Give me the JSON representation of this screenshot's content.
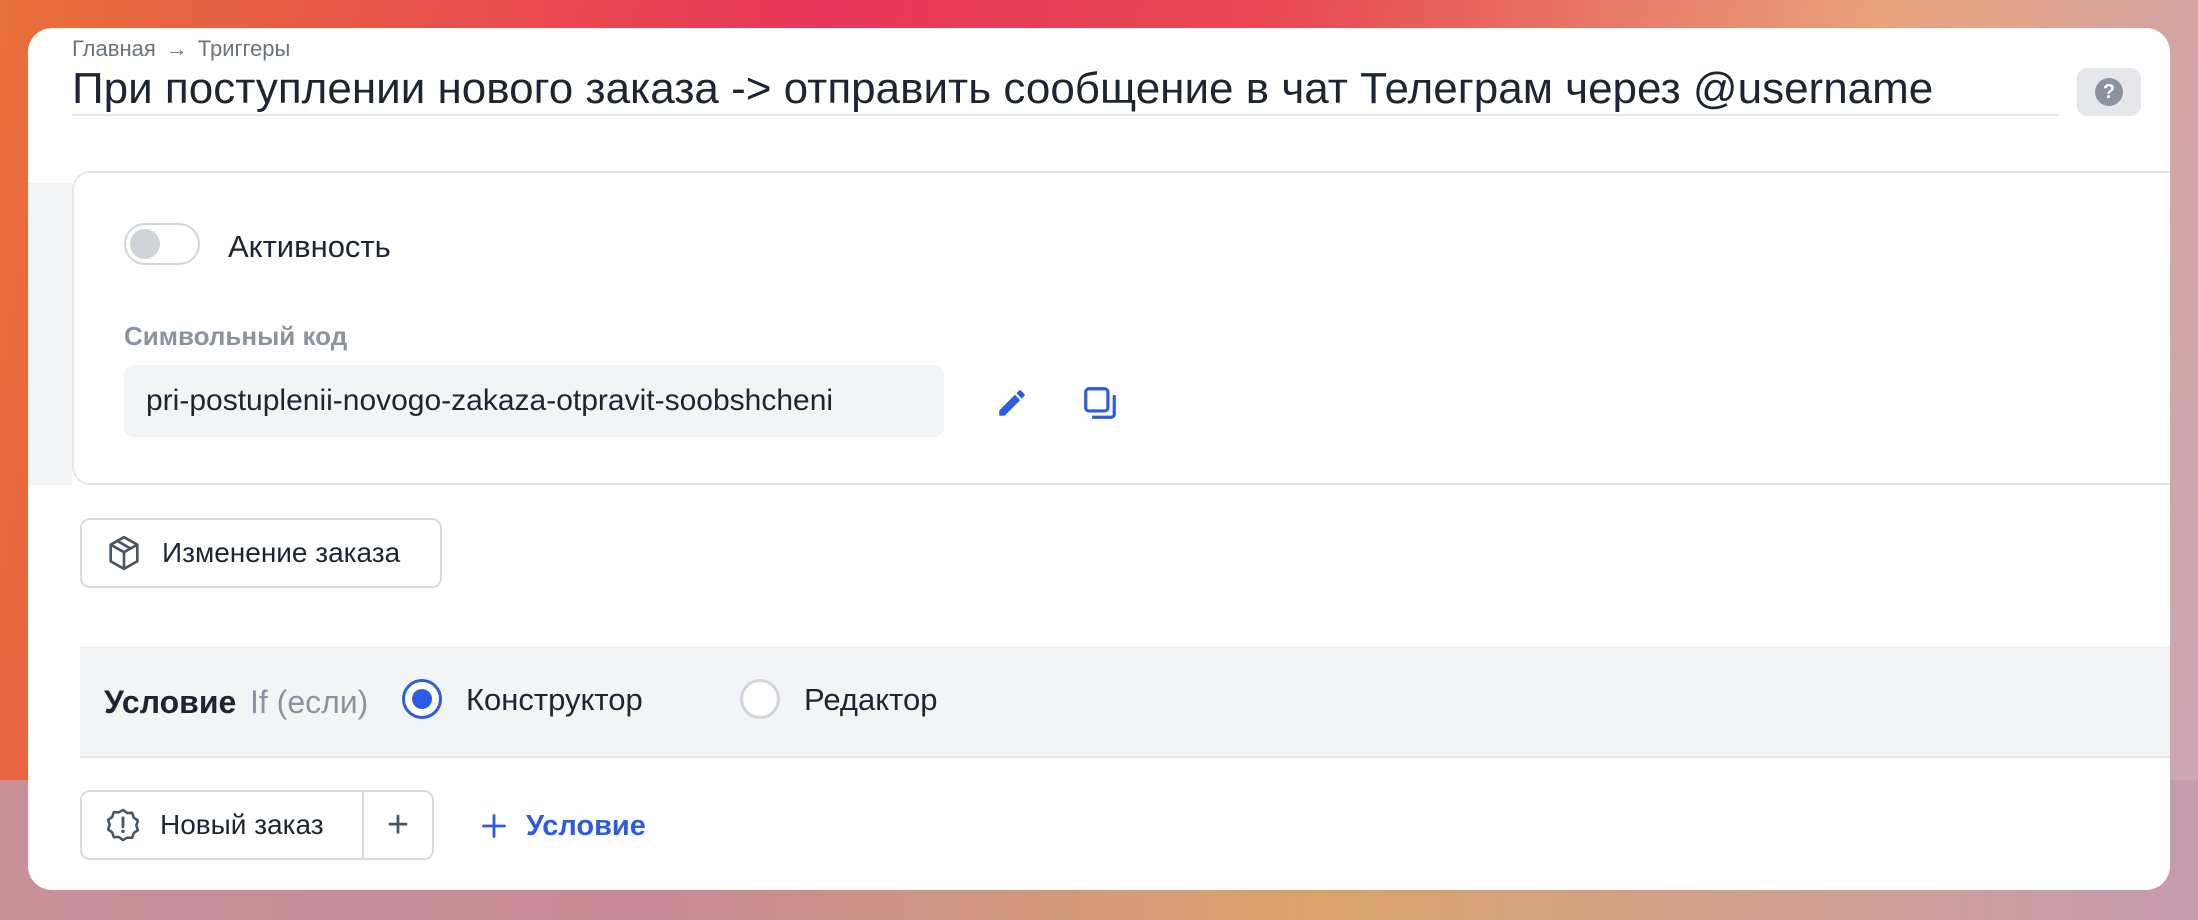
{
  "breadcrumb": {
    "home": "Главная",
    "separator": "→",
    "current": "Триггеры"
  },
  "page": {
    "title": "При поступлении нового заказа -> отправить сообщение в чат Телеграм через @username",
    "help_symbol": "?"
  },
  "settings": {
    "activity_label": "Активность",
    "activity_enabled": false,
    "code_label": "Символьный код",
    "code_value": "pri-postuplenii-novogo-zakaza-otpravit-soobshcheni"
  },
  "event": {
    "label": "Изменение заказа",
    "icon": "cube-icon"
  },
  "condition": {
    "title": "Условие",
    "subtitle": "If (если)",
    "modes": [
      {
        "label": "Конструктор",
        "selected": true
      },
      {
        "label": "Редактор",
        "selected": false
      }
    ]
  },
  "condition_items": {
    "new_order_label": "Новый заказ",
    "new_order_icon": "alert-badge-icon",
    "plus_symbol": "+",
    "add_condition_label": "Условие"
  },
  "colors": {
    "accent": "#2d5be3",
    "text": "#1f2433",
    "muted": "#8b93a1"
  }
}
